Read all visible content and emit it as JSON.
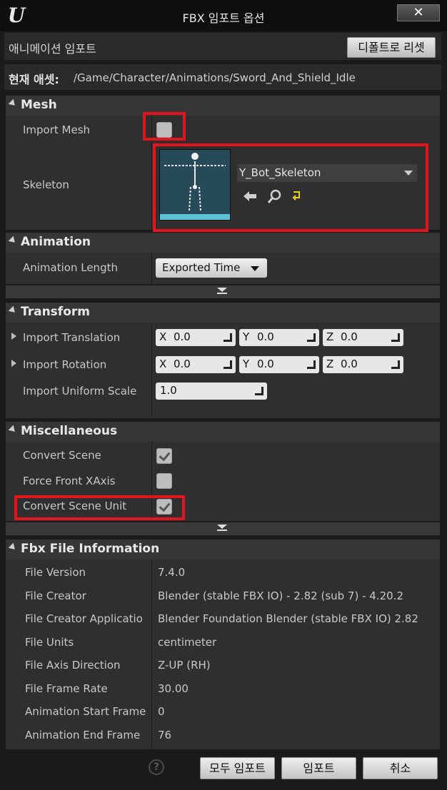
{
  "window": {
    "title": "FBX 임포트 옵션",
    "close_label": "✕"
  },
  "header": {
    "section_label": "애니메이션 임포트",
    "reset_label": "디폴트로 리셋"
  },
  "asset": {
    "label": "현재 애셋:",
    "path": "/Game/Character/Animations/Sword_And_Shield_Idle"
  },
  "mesh": {
    "title": "Mesh",
    "import_mesh_label": "Import Mesh",
    "import_mesh_checked": false,
    "skeleton_label": "Skeleton",
    "skeleton_value": "Y_Bot_Skeleton"
  },
  "animation": {
    "title": "Animation",
    "length_label": "Animation Length",
    "length_value": "Exported Time"
  },
  "transform": {
    "title": "Transform",
    "translation": {
      "label": "Import Translation",
      "x_axis": "X",
      "x": "0.0",
      "y_axis": "Y",
      "y": "0.0",
      "z_axis": "Z",
      "z": "0.0"
    },
    "rotation": {
      "label": "Import Rotation",
      "x_axis": "X",
      "x": "0.0",
      "y_axis": "Y",
      "y": "0.0",
      "z_axis": "Z",
      "z": "0.0"
    },
    "scale": {
      "label": "Import Uniform Scale",
      "value": "1.0"
    }
  },
  "misc": {
    "title": "Miscellaneous",
    "convert_scene": {
      "label": "Convert Scene",
      "checked": true
    },
    "force_front": {
      "label": "Force Front XAxis",
      "checked": false
    },
    "convert_unit": {
      "label": "Convert Scene Unit",
      "checked": true
    }
  },
  "fbx_info": {
    "title": "Fbx File Information",
    "rows": [
      {
        "label": "File Version",
        "value": "7.4.0"
      },
      {
        "label": "File Creator",
        "value": "Blender (stable FBX IO) - 2.82 (sub 7) - 4.20.2"
      },
      {
        "label": "File Creator Applicatio",
        "value": "Blender Foundation Blender (stable FBX IO) 2.82"
      },
      {
        "label": "File Units",
        "value": "centimeter"
      },
      {
        "label": "File Axis Direction",
        "value": "Z-UP (RH)"
      },
      {
        "label": "File Frame Rate",
        "value": "30.00"
      },
      {
        "label": "Animation Start Frame",
        "value": "0"
      },
      {
        "label": "Animation End Frame",
        "value": "76"
      }
    ]
  },
  "footer": {
    "help_label": "?",
    "import_all_label": "모두 임포트",
    "import_label": "임포트",
    "cancel_label": "취소"
  },
  "icons": {
    "logo": "unreal-logo-icon",
    "back": "arrow-left-icon",
    "browse": "magnifier-icon",
    "reset": "reset-arrow-icon",
    "dropdown": "chevron-down-icon"
  },
  "colors": {
    "highlight": "#e3141b",
    "panel": "#2f2f2f",
    "header": "#363636"
  }
}
